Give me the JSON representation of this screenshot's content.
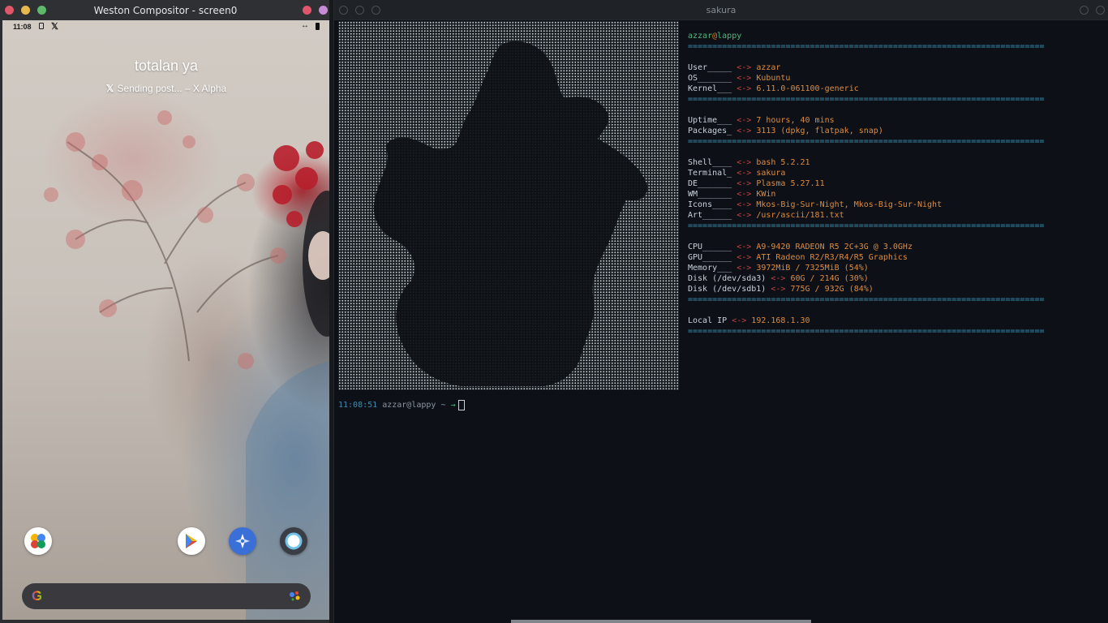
{
  "weston": {
    "title": "Weston Compositor - screen0",
    "phone": {
      "status_time": "11:08",
      "status_x": "𝕏",
      "status_arrows": "↔",
      "notification_title": "totalan ya",
      "notification_icon": "𝕏",
      "notification_text": "Sending post... – X Alpha",
      "search_logo": "G"
    }
  },
  "sakura": {
    "title": "sakura",
    "user": "azzar",
    "at": "@",
    "host": "lappy",
    "separator": "=========================================================================",
    "info_groups": [
      [
        {
          "key": "User_____",
          "arrow": "<->",
          "value": "azzar"
        },
        {
          "key": "OS_______",
          "arrow": "<->",
          "value": "Kubuntu"
        },
        {
          "key": "Kernel___",
          "arrow": "<->",
          "value": "6.11.0-061100-generic"
        }
      ],
      [
        {
          "key": "Uptime___",
          "arrow": "<->",
          "value": "7 hours, 40 mins"
        },
        {
          "key": "Packages_",
          "arrow": "<->",
          "value": "3113 (dpkg, flatpak, snap)"
        }
      ],
      [
        {
          "key": "Shell____",
          "arrow": "<->",
          "value": "bash 5.2.21"
        },
        {
          "key": "Terminal_",
          "arrow": "<->",
          "value": "sakura"
        },
        {
          "key": "DE_______",
          "arrow": "<->",
          "value": "Plasma 5.27.11"
        },
        {
          "key": "WM_______",
          "arrow": "<->",
          "value": "KWin"
        },
        {
          "key": "Icons____",
          "arrow": "<->",
          "value": "Mkos-Big-Sur-Night, Mkos-Big-Sur-Night"
        },
        {
          "key": "Art______",
          "arrow": "<->",
          "value": "/usr/ascii/181.txt"
        }
      ],
      [
        {
          "key": "CPU______",
          "arrow": "<->",
          "value": "A9-9420 RADEON R5 2C+3G @ 3.0GHz"
        },
        {
          "key": "GPU______",
          "arrow": "<->",
          "value": "ATI Radeon R2/R3/R4/R5 Graphics"
        },
        {
          "key": "Memory___",
          "arrow": "<->",
          "value": "3972MiB / 7325MiB (54%)"
        },
        {
          "key": "Disk (/dev/sda3)",
          "arrow": "<->",
          "value": "60G / 214G (30%)"
        },
        {
          "key": "Disk (/dev/sdb1)",
          "arrow": "<->",
          "value": "775G / 932G (84%)"
        }
      ],
      [
        {
          "key": "Local IP",
          "arrow": "<->",
          "value": "192.168.1.30"
        }
      ]
    ],
    "prompt": {
      "time": "11:08:51",
      "user_host": "azzar@lappy",
      "path": "~",
      "arrow": "→"
    }
  },
  "colors": {
    "terminal_bg": "#0d1117",
    "separator": "#3b8eb0",
    "arrow": "#c64040",
    "value": "#e08a3a",
    "user": "#4fb87a"
  }
}
